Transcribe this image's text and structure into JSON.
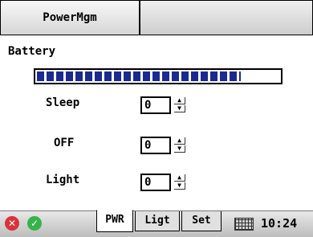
{
  "window": {
    "title": "PowerMgm"
  },
  "battery": {
    "label": "Battery",
    "level": 0.84
  },
  "settings": [
    {
      "label": "Sleep",
      "value": "0"
    },
    {
      "label": "OFF",
      "value": "0"
    },
    {
      "label": "Light",
      "value": "0"
    }
  ],
  "tabs": [
    "PWR",
    "Ligt",
    "Set"
  ],
  "taskbar": {
    "time": "10:24",
    "close_symbol": "✕",
    "ok_symbol": "✓"
  },
  "colors": {
    "progress_fill": "#1b2a8f",
    "close": "#d9323a",
    "ok": "#37b24d"
  },
  "icons": [
    "close-icon",
    "ok-icon",
    "keyboard-icon",
    "spin-up-icon",
    "spin-down-icon"
  ]
}
